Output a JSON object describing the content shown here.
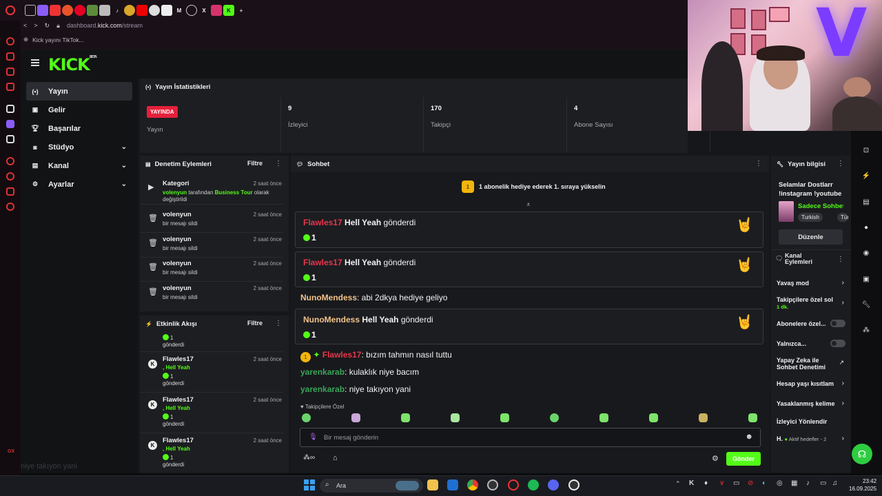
{
  "browser": {
    "url_prefix": "dashboard.",
    "url_domain": "kick.com",
    "url_path": "/stream",
    "bookmark": "Kick yayını TikTok..."
  },
  "app": {
    "logo": "KICK",
    "logo_sup": "BETA"
  },
  "sidebar": {
    "items": [
      {
        "label": "Yayın",
        "icon": "broadcast-icon"
      },
      {
        "label": "Gelir",
        "icon": "revenue-icon"
      },
      {
        "label": "Başarılar",
        "icon": "trophy-icon"
      },
      {
        "label": "Stüdyo",
        "icon": "studio-icon"
      },
      {
        "label": "Kanal",
        "icon": "channel-icon"
      },
      {
        "label": "Ayarlar",
        "icon": "gear-icon"
      }
    ]
  },
  "stats": {
    "title": "Yayın İstatistikleri",
    "live_badge": "YAYINDA",
    "stream_label": "Yayın",
    "viewers_value": "9",
    "viewers_label": "İzleyici",
    "followers_value": "170",
    "followers_label": "Takipçi",
    "subs_value": "4",
    "subs_label": "Abone Sayısı"
  },
  "moderation": {
    "title": "Denetim Eylemleri",
    "filter": "Filtre",
    "rows": [
      {
        "title": "Kategori",
        "time": "2 saat önce",
        "user": "volenyun",
        "mid": "tarafından",
        "cat": "Business Tour",
        "tail": "olarak",
        "tail2": "değiştirildi"
      },
      {
        "title": "volenyun",
        "time": "2 saat önce",
        "sub": "bir mesajı sildi"
      },
      {
        "title": "volenyun",
        "time": "2 saat önce",
        "sub": "bir mesajı sildi"
      },
      {
        "title": "volenyun",
        "time": "2 saat önce",
        "sub": "bir mesajı sildi"
      },
      {
        "title": "volenyun",
        "time": "2 saat önce",
        "sub": "bir mesajı sildi"
      }
    ]
  },
  "activity": {
    "title": "Etkinlik Akışı",
    "filter": "Filtre",
    "partial_qty": "1",
    "partial_sent": "gönderdi",
    "rows": [
      {
        "name": "Flawles17",
        "time": "2 saat önce",
        "gift": ", Hell Yeah",
        "qty": "1",
        "sent": "gönderdi"
      },
      {
        "name": "Flawles17",
        "time": "2 saat önce",
        "gift": ", Hell Yeah",
        "qty": "1",
        "sent": "gönderdi"
      },
      {
        "name": "Flawles17",
        "time": "2 saat önce",
        "gift": ", Hell Yeah",
        "qty": "1",
        "sent": "gönderdi"
      }
    ]
  },
  "chat": {
    "title": "Sohbet",
    "banner_rank": "1",
    "banner": "1 abonelik hediye ederek 1. sıraya yükselin",
    "gifts": [
      {
        "user": "Flawles17",
        "item": "Hell Yeah",
        "verb": "gönderdi",
        "qty": "1"
      },
      {
        "user": "Flawles17",
        "item": "Hell Yeah",
        "verb": "gönderdi",
        "qty": "1"
      },
      {
        "user": "NunoMendess",
        "item": "Hell Yeah",
        "verb": "gönderdi",
        "qty": "1"
      }
    ],
    "messages": [
      {
        "user": "NunoMendess",
        "text": ": abi 2dkya hediye geliyo"
      },
      {
        "user": "Flawles17",
        "text": ": bızım tahmın nasıl tuttu",
        "badge": "1"
      },
      {
        "user": "yarenkarab",
        "text": ": kulaklık niye bacım"
      },
      {
        "user": "yarenkarab",
        "text": ": niye takıyon yani"
      }
    ],
    "followers_only": "Takipçilere Özel",
    "input_placeholder": "Bir mesaj gönderin",
    "send": "Gönder"
  },
  "stream_info": {
    "title": "Yayın bilgisi",
    "text1": "Selamlar Dostlarr",
    "text2": "!instagram !youtube",
    "category": "Sadece Sohbet",
    "tag1": "Turkish",
    "tag2": "Türk",
    "edit": "Düzenle"
  },
  "channel_actions": {
    "title1": "Kanal",
    "title2": "Eylemleri",
    "items": [
      {
        "label": "Yavaş mod"
      },
      {
        "label": "Takipçilere özel sol",
        "sub": "1 dk."
      },
      {
        "label": "Abonelere özel..."
      },
      {
        "label": "Yalnızca..."
      },
      {
        "label": "Yapay Zeka ile",
        "label2": "Sohbet Denetimi"
      },
      {
        "label": "Hesap yaşı kısıtlam"
      },
      {
        "label": "Yasaklanmış kelime"
      },
      {
        "label": "İzleyici Yönlendir"
      },
      {
        "label": "H.",
        "sub": "Aktif hedefler - 2"
      }
    ]
  },
  "taskbar": {
    "search": "Ara",
    "time": "23:42",
    "date": "16.09.2025"
  },
  "overlay": "niye takıyon yani",
  "gx": "GX",
  "colors": {
    "accent": "#53fc18",
    "live": "#e5203a"
  }
}
